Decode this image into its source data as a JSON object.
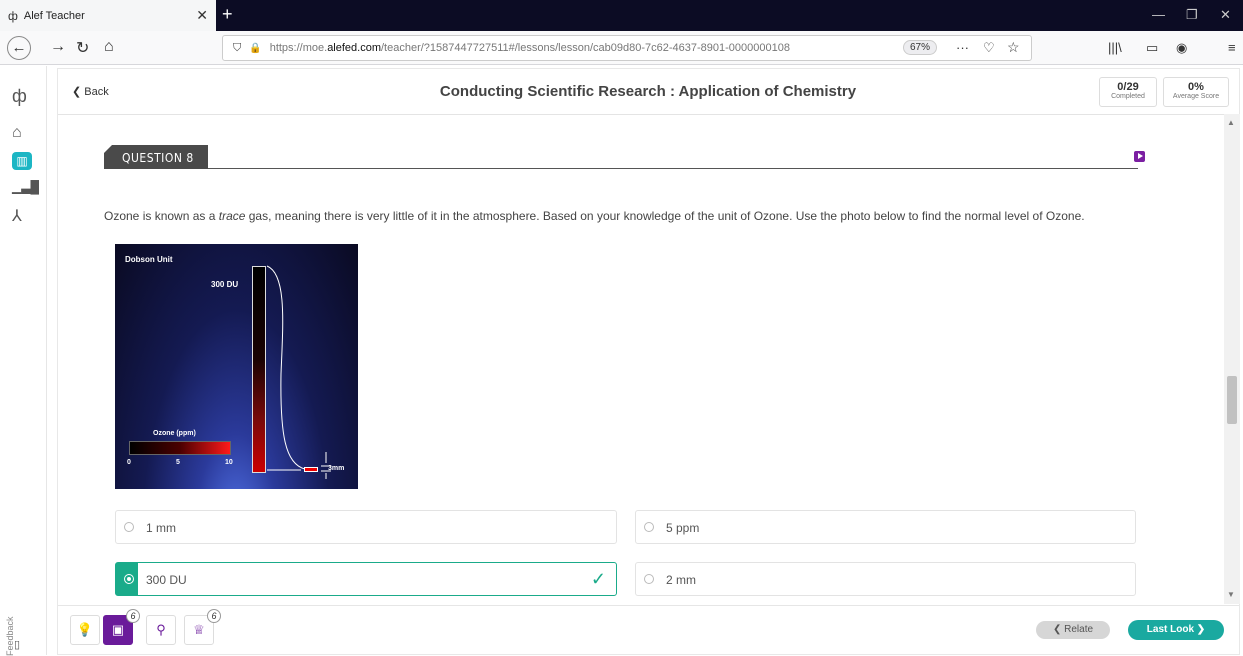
{
  "browser": {
    "tab_title": "Alef Teacher",
    "url_prefix": "https://moe.",
    "url_domain": "alefed.com",
    "url_path": "/teacher/?1587447727511#/lessons/lesson/cab09d80-7c62-4637-8901-0000000108",
    "zoom": "67%"
  },
  "header": {
    "back_label": "Back",
    "title": "Conducting Scientific Research : Application of Chemistry",
    "completed_value": "0/29",
    "completed_label": "Completed",
    "score_value": "0%",
    "score_label": "Average Score"
  },
  "question": {
    "label": "QUESTION 8",
    "text_before": "Ozone is known as a ",
    "text_italic": "trace",
    "text_after": " gas, meaning there is very little of it in the atmosphere. Based on your knowledge of the unit of Ozone. Use the photo below to find the normal level of Ozone.",
    "image": {
      "title": "Dobson Unit",
      "column_label": "300 DU",
      "scale_label": "Ozone (ppm)",
      "ticks": [
        "0",
        "5",
        "10"
      ],
      "thickness_label": "3mm"
    },
    "options": [
      {
        "label": "1 mm",
        "selected": false
      },
      {
        "label": "5 ppm",
        "selected": false
      },
      {
        "label": "300 DU",
        "selected": true
      },
      {
        "label": "2 mm",
        "selected": false
      }
    ]
  },
  "sidebar": {
    "feedback_label": "Feedback"
  },
  "bottom": {
    "badge_count_1": "6",
    "badge_count_2": "6",
    "relate_label": "Relate",
    "lastlook_label": "Last Look"
  },
  "colors": {
    "accent_teal": "#1aab8a",
    "accent_purple": "#6a1b9a"
  }
}
